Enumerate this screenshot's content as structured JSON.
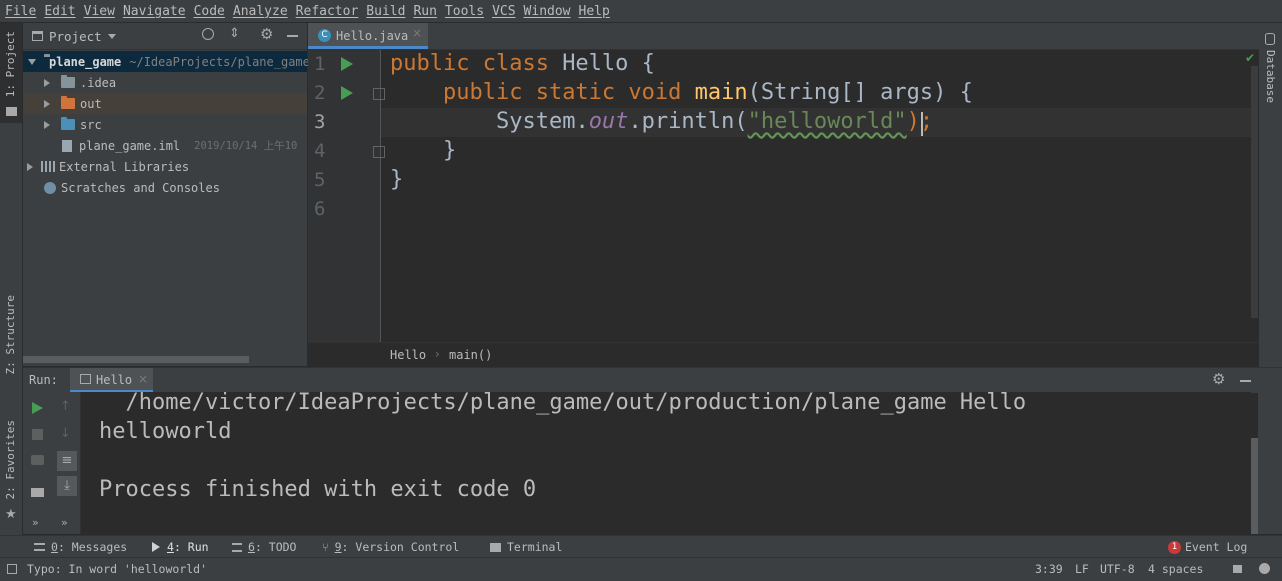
{
  "menu": [
    "File",
    "Edit",
    "View",
    "Navigate",
    "Code",
    "Analyze",
    "Refactor",
    "Build",
    "Run",
    "Tools",
    "VCS",
    "Window",
    "Help"
  ],
  "left_strip": {
    "project_label": "1: Project",
    "structure_label": "Z: Structure",
    "favorites_label": "2: Favorites"
  },
  "right_strip": {
    "database_label": "Database"
  },
  "project_panel": {
    "title": "Project",
    "root": {
      "name": "plane_game",
      "path": "~/IdeaProjects/plane_game"
    },
    "items": [
      {
        "name": ".idea"
      },
      {
        "name": "out"
      },
      {
        "name": "src"
      },
      {
        "name": "plane_game.iml",
        "meta": "2019/10/14 上午10"
      },
      {
        "name": "External Libraries"
      },
      {
        "name": "Scratches and Consoles"
      }
    ]
  },
  "editor": {
    "tab": "Hello.java",
    "line_numbers": [
      "1",
      "2",
      "3",
      "4",
      "5",
      "6"
    ],
    "lines": {
      "l1": {
        "kw": "public class ",
        "rest": "Hello {"
      },
      "l2": {
        "indent": "    ",
        "kw": "public static void ",
        "fn": "main",
        "rest": "(String[] args) {"
      },
      "l3": {
        "indent": "        ",
        "a": "System.",
        "fld": "out",
        "b": ".println(",
        "str": "\"helloworld\"",
        "c": ");"
      },
      "l4": {
        "indent": "    ",
        "text": "}"
      },
      "l5": {
        "text": "}"
      }
    },
    "breadcrumb": [
      "Hello",
      "main()"
    ]
  },
  "run": {
    "label": "Run:",
    "tab": "Hello",
    "output": [
      "  /home/victor/IdeaProjects/plane_game/out/production/plane_game Hello",
      "helloworld",
      "",
      "Process finished with exit code 0"
    ]
  },
  "tool_windows": {
    "messages": {
      "num": "0",
      "label": ": Messages"
    },
    "run": {
      "num": "4",
      "label": ": Run"
    },
    "todo": {
      "num": "6",
      "label": ": TODO"
    },
    "vcs": {
      "num": "9",
      "label": ": Version Control"
    },
    "terminal": {
      "label": "Terminal"
    },
    "event_log": {
      "badge": "1",
      "label": "Event Log"
    }
  },
  "status": {
    "message": "Typo: In word 'helloworld'",
    "position": "3:39",
    "line_sep": "LF",
    "encoding": "UTF-8",
    "indent": "4 spaces"
  },
  "colors": {
    "accent_green": "#499c54",
    "keyword": "#cc7832",
    "string": "#6a8759",
    "function": "#ffc66d",
    "field": "#9876aa",
    "folder_blue": "#87939a",
    "folder_orange": "#d0743c",
    "error_red": "#c93b3b"
  }
}
